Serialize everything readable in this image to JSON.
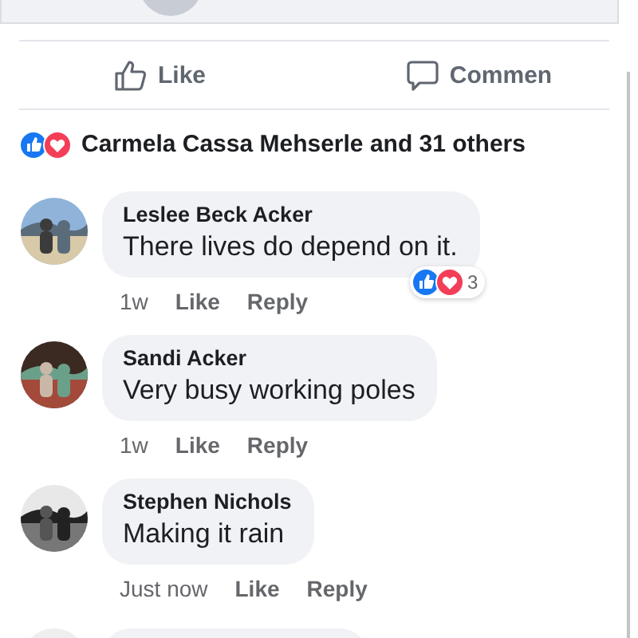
{
  "actions": [
    {
      "kind": "like",
      "label": "Like"
    },
    {
      "kind": "comment",
      "label": "Commen"
    }
  ],
  "reaction_summary": {
    "reactions": [
      {
        "kind": "like"
      },
      {
        "kind": "love"
      }
    ],
    "text": "Carmela Cassa Mehserle and 31 others"
  },
  "comments": [
    {
      "kind": "comment",
      "author": "Leslee Beck Acker",
      "text": "There lives do depend on it.",
      "time": "1w",
      "like": "Like",
      "reply": "Reply",
      "reactions": {
        "types": [
          {
            "kind": "like"
          },
          {
            "kind": "love"
          }
        ],
        "count": "3"
      }
    },
    {
      "kind": "comment",
      "author": "Sandi Acker",
      "text": "Very busy working poles",
      "time": "1w",
      "like": "Like",
      "reply": "Reply"
    },
    {
      "kind": "comment",
      "author": "Stephen Nichols",
      "text": "Making it rain",
      "time": "Just now",
      "like": "Like",
      "reply": "Reply"
    },
    {
      "kind": "cut"
    }
  ]
}
